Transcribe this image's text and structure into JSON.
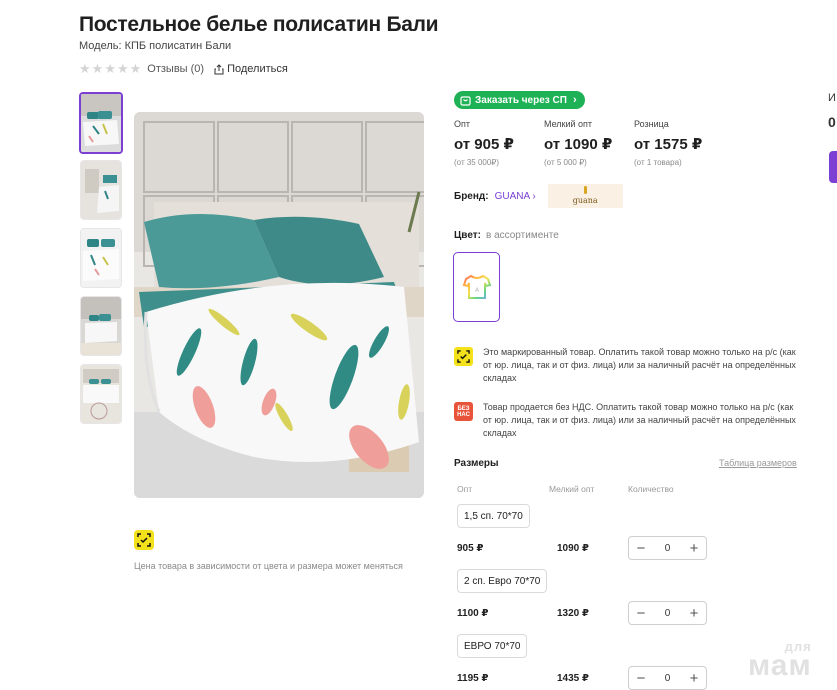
{
  "product": {
    "title": "Постельное белье полисатин Бали",
    "model": "Модель: КПБ полисатин Бали",
    "reviews": "Отзывы (0)",
    "share": "Поделиться"
  },
  "order_button": "Заказать через СП",
  "prices": [
    {
      "label": "Опт",
      "value": "от 905 ₽",
      "note": "(от 35 000₽)"
    },
    {
      "label": "Мелкий опт",
      "value": "от 1090 ₽",
      "note": "(от 5 000 ₽)"
    },
    {
      "label": "Розница",
      "value": "от 1575 ₽",
      "note": "(от 1 товара)"
    }
  ],
  "brand": {
    "label": "Бренд:",
    "name": "GUANA",
    "logo_text": "guana"
  },
  "color": {
    "label": "Цвет:",
    "value": "в ассортименте"
  },
  "notices": [
    {
      "text": "Это маркированный товар. Оплатить такой товар можно только на р/с (как от юр. лица, так и от физ. лица) или за наличный расчёт на определённых складах"
    },
    {
      "icon_text": "БЕЗ НАС",
      "text": "Товар продается без НДС. Оплатить такой товар можно только на р/с (как от юр. лица, так и от физ. лица) или за наличный расчёт на определённых складах"
    }
  ],
  "price_note": "Цена товара в зависимости от цвета и размера может меняться",
  "sizes": {
    "title": "Размеры",
    "table_link": "Таблица размеров",
    "headers": {
      "opt": "Опт",
      "small_opt": "Мелкий опт",
      "qty": "Количество"
    },
    "rows": [
      {
        "name": "1,5 сп. 70*70",
        "opt": "905 ₽",
        "small_opt": "1090 ₽",
        "qty": "0"
      },
      {
        "name": "2 сп. Евро 70*70",
        "opt": "1100 ₽",
        "small_opt": "1320 ₽",
        "qty": "0"
      },
      {
        "name": "ЕВРО 70*70",
        "opt": "1195 ₽",
        "small_opt": "1435 ₽",
        "qty": "0"
      }
    ]
  },
  "edge": {
    "top_text": "И",
    "second_text": "0"
  },
  "watermark": {
    "top": "для",
    "bottom": "мам"
  },
  "colors": {
    "accent": "#7b3fd4",
    "green": "#1fb155",
    "mark_yellow": "#f3e21b",
    "no_vat_red": "#e8543a"
  }
}
